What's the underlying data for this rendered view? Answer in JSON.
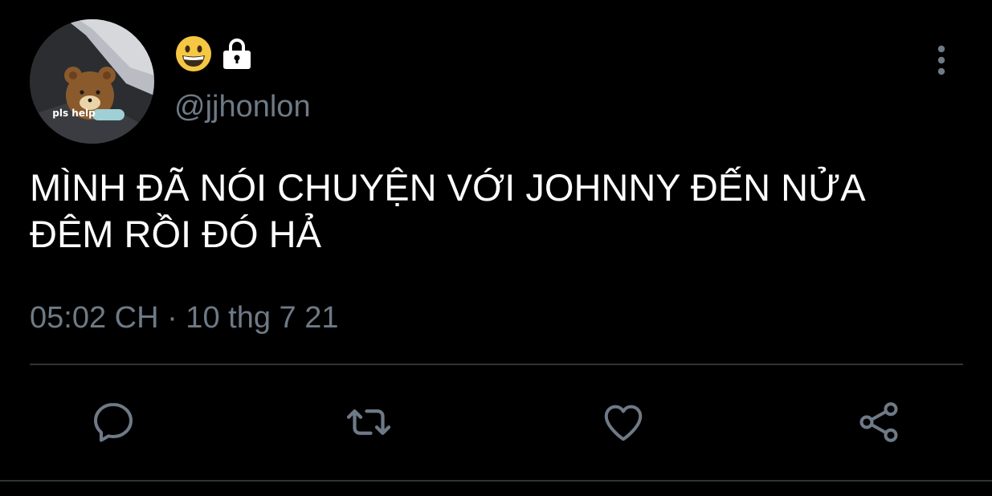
{
  "author": {
    "avatar_caption": "pls help",
    "handle": "@jjhonlon",
    "display_icons": [
      "grinning-face-emoji",
      "lock-emoji"
    ]
  },
  "tweet": {
    "text_line1": "MÌNH ĐÃ NÓI CHUYỆN VỚI JOHNNY ĐẾN NỬA",
    "text_line2": "ĐÊM RỒI ĐÓ HẢ",
    "timestamp": "05:02 CH · 10 thg 7 21"
  },
  "actions": [
    "reply-icon",
    "retweet-icon",
    "like-icon",
    "share-icon"
  ],
  "colors": {
    "background": "#000000",
    "text": "#ffffff",
    "secondary_text": "#6e7a86",
    "divider": "#2f3336",
    "icon": "#6e7a86"
  }
}
